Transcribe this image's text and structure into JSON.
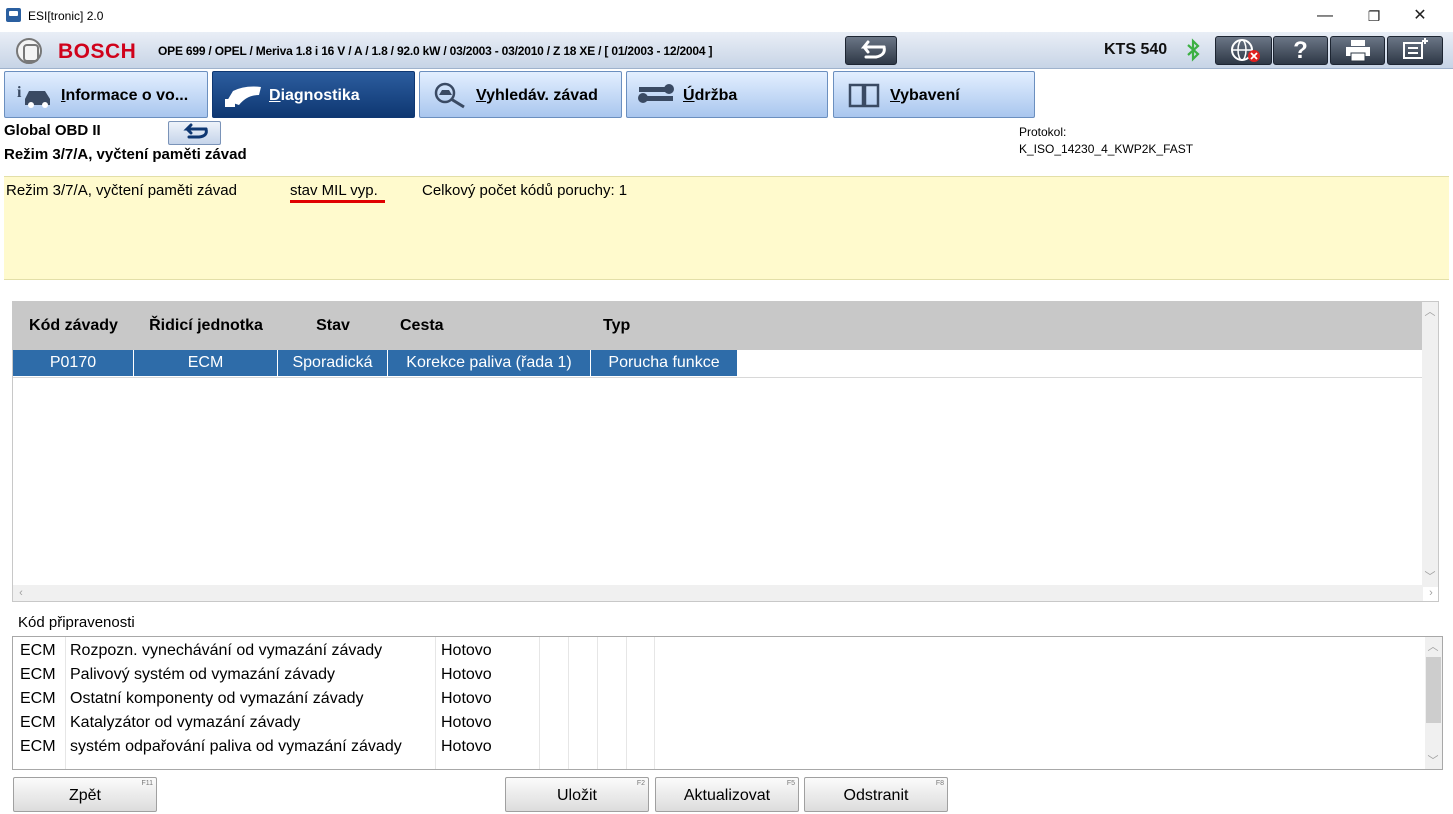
{
  "window": {
    "title": "ESI[tronic] 2.0",
    "controls": {
      "minimize": "—",
      "restore": "❐",
      "close": "✕"
    }
  },
  "header": {
    "brand": "BOSCH",
    "vehicle": "OPE 699 / OPEL / Meriva 1.8 i 16 V / A / 1.8 / 92.0 kW / 03/2003 - 03/2010 / Z 18 XE / [ 01/2003 - 12/2004 ]",
    "device": "KTS 540",
    "icons": [
      "back-arrow-icon",
      "bluetooth-icon",
      "globe-offline-icon",
      "help-icon",
      "print-icon",
      "menu-icon"
    ],
    "help_glyph": "?"
  },
  "tabs": [
    {
      "label": "Informace o vo...",
      "icon": "car-info-icon",
      "active": false
    },
    {
      "label": "Diagnostika",
      "icon": "diagnostic-plug-icon",
      "active": true
    },
    {
      "label": "Vyhledáv. závad",
      "icon": "search-car-icon",
      "active": false
    },
    {
      "label": "Údržba",
      "icon": "wrench-icon",
      "active": false
    },
    {
      "label": "Vybavení",
      "icon": "book-icon",
      "active": false
    }
  ],
  "page": {
    "title": "Global OBD II",
    "subtitle": "Režim 3/7/A, vyčtení paměti závad",
    "protocol_label": "Protokol:",
    "protocol_value": "K_ISO_14230_4_KWP2K_FAST"
  },
  "info": {
    "mode": "Režim 3/7/A, vyčtení paměti závad",
    "mil": "stav MIL vyp.",
    "count": "Celkový počet kódů poruchy: 1"
  },
  "faults": {
    "headers": [
      "Kód závady",
      "Řidicí jednotka",
      "Stav",
      "Cesta",
      "Typ"
    ],
    "rows": [
      [
        "P0170",
        "ECM",
        "Sporadická",
        "Korekce paliva (řada 1)",
        "Porucha funkce"
      ]
    ]
  },
  "readiness": {
    "label": "Kód připravenosti",
    "rows": [
      [
        "ECM",
        "Rozpozn. vynechávání od vymazání závady",
        "Hotovo"
      ],
      [
        "ECM",
        "Palivový systém od vymazání závady",
        "Hotovo"
      ],
      [
        "ECM",
        "Ostatní komponenty od vymazání závady",
        "Hotovo"
      ],
      [
        "ECM",
        "Katalyzátor od vymazání závady",
        "Hotovo"
      ],
      [
        "ECM",
        "systém odpařování paliva od vymazání závady",
        "Hotovo"
      ]
    ]
  },
  "buttons": {
    "back": {
      "label": "Zpět",
      "key": "F11"
    },
    "save": {
      "label": "Uložit",
      "key": "F2"
    },
    "refresh": {
      "label": "Aktualizovat",
      "key": "F5"
    },
    "delete": {
      "label": "Odstranit",
      "key": "F8"
    }
  },
  "colors": {
    "brand_red": "#d0021b",
    "selected_row": "#2e6ca9",
    "info_panel": "#fffacd",
    "active_tab": "#0e3772"
  }
}
